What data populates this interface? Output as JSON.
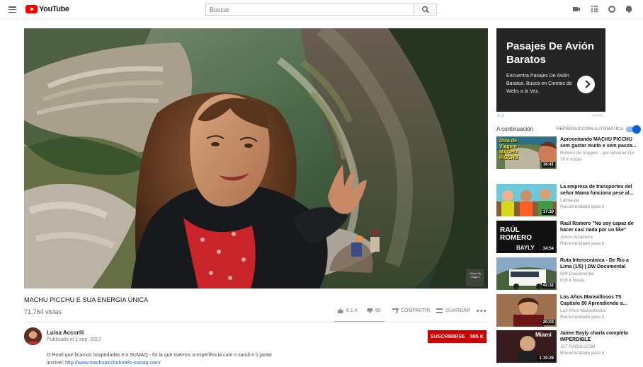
{
  "header": {
    "logo_text": "YouTube",
    "search_placeholder": "Buscar",
    "icons": [
      "menu-icon",
      "youtube-logo-icon",
      "search-icon",
      "upload-video-icon",
      "apps-grid-icon",
      "messages-icon",
      "notifications-icon"
    ]
  },
  "video": {
    "title": "MACHU PICCHU E SUA ENERGIA ÚNICA",
    "views": "71,764 vistas",
    "likes": "6.1 K",
    "dislikes": "60",
    "share_label": "COMPARTIR",
    "save_label": "GUARDAR",
    "watermark": "Dicas da Viagem"
  },
  "channel": {
    "name": "Luisa Accorsi",
    "published": "Publicado el 1 sep. 2017",
    "subscribe_label": "SUSCRIBIRSE",
    "subscriber_count": "585 K",
    "description": "O Hotel que ficamos hospedadas é o SUMAQ - foi lá que tivemos a experiência com o xamã e o jantar incrível:",
    "description_link": "http://www.machupicchuhotels-sumaq.com/"
  },
  "ad": {
    "title": "Pasajes De Avión Baratos",
    "text": "Encuentra Pasajes De Avión Baratos. Busca en Cientos de Webs a la Vez.",
    "choices": "✕⊙",
    "sponsor": "KAYAK"
  },
  "sidebar": {
    "up_next": "A continuación",
    "autoplay": "REPRODUCCIÓN AUTOMÁTICA",
    "autoplay_on": true,
    "videos": [
      {
        "title": "Aproveitando MACHU PICCHU sem gastar muito e sem passa...",
        "channel": "Roteiro de Viagem - por Wiviane Go",
        "meta": "10 k vistas",
        "duration": "18:41",
        "thumb_text": "Dica de Viagem MACHU PICCHU"
      },
      {
        "title": "La empresa de transportes del señor Mama funciona pese al...",
        "channel": "Latina.pe",
        "meta": "Recomendado para ti",
        "duration": "17:30"
      },
      {
        "title": "Raúl Romero \"No soy capaz de hacer casi nada por un like\"",
        "channel": "Jesus Alzamora",
        "meta": "Recomendado para ti",
        "duration": "34:54",
        "thumb_text": "RAÚL ROMERO",
        "thumb_subtext": "BAYLY"
      },
      {
        "title": "Ruta Interoceánica - De Río a Lima (1/5) | DW Documental",
        "channel": "DW Documental",
        "meta": "816 k vistas",
        "duration": "42:32"
      },
      {
        "title": "Los Años Maravillosos T5 Capítulo 80 Aprendiendo a...",
        "channel": "Los Años Maravillosos",
        "meta": "Recomendado para ti",
        "duration": "20:03"
      },
      {
        "title": "Jaime Bayly charla completa IMPERDIBLE",
        "channel": "JLT RADIO.COM",
        "meta": "Recomendado para ti",
        "duration": "1:19:29",
        "thumb_text": "Miami"
      }
    ]
  }
}
